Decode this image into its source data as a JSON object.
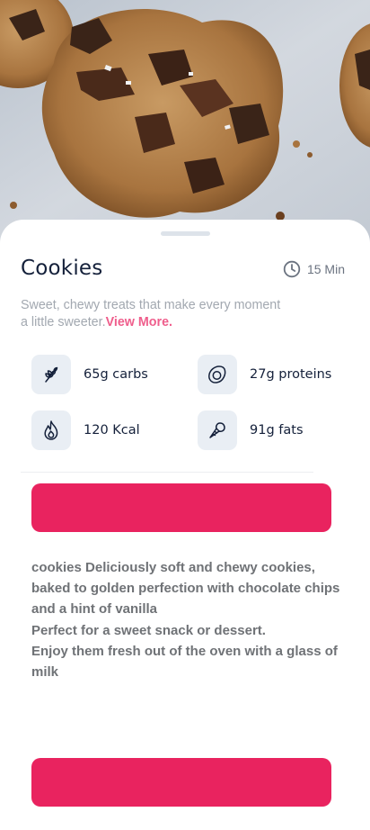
{
  "recipe": {
    "title": "Cookies",
    "time": "15 Min",
    "description": "Sweet, chewy treats that make every moment a little sweeter.",
    "view_more": "View More."
  },
  "nutrition": {
    "carbs": {
      "label": "65g carbs",
      "icon": "wheat-icon"
    },
    "proteins": {
      "label": "27g proteins",
      "icon": "egg-icon"
    },
    "calories": {
      "label": "120 Kcal",
      "icon": "flame-icon"
    },
    "fats": {
      "label": "91g fats",
      "icon": "cone-icon"
    }
  },
  "actions": {
    "primary_label": "",
    "secondary_label": ""
  },
  "details": {
    "text": "cookies Deliciously soft and chewy cookies, baked to golden perfection with chocolate chips and a hint of vanilla\nPerfect for a sweet snack or dessert.\nEnjoy them fresh out of the oven with a glass of milk"
  },
  "colors": {
    "accent": "#e9235f",
    "link": "#ef5e8c",
    "title": "#14203a",
    "muted": "#a2a8b0",
    "icon_bg": "#e9eef4"
  }
}
